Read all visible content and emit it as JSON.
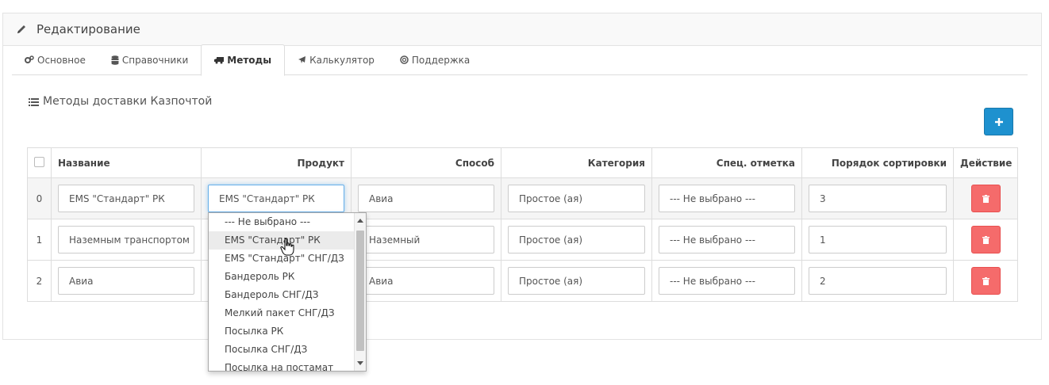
{
  "panel": {
    "title": "Редактирование",
    "icon": "pencil-icon"
  },
  "tabs": [
    {
      "label": "Основное",
      "icon": "cogs-icon",
      "active": false
    },
    {
      "label": "Справочники",
      "icon": "database-icon",
      "active": false
    },
    {
      "label": "Методы",
      "icon": "truck-icon",
      "active": true
    },
    {
      "label": "Калькулятор",
      "icon": "plane-icon",
      "active": false
    },
    {
      "label": "Поддержка",
      "icon": "life-ring-icon",
      "active": false
    }
  ],
  "section": {
    "title": "Методы доставки Казпочтой",
    "icon": "list-icon",
    "add_button_icon": "plus-icon"
  },
  "table": {
    "headers": {
      "name": "Название",
      "product": "Продукт",
      "method": "Способ",
      "category": "Категория",
      "special": "Спец. отметка",
      "sort": "Порядок сортировки",
      "action": "Действие"
    },
    "rows": [
      {
        "index": "0",
        "name": "EMS \"Стандарт\" РК",
        "product": "EMS \"Стандарт\" РК",
        "method": "Авиа",
        "category": "Простое (ая)",
        "special": "--- Не выбрано ---",
        "sort": "3"
      },
      {
        "index": "1",
        "name": "Наземным транспортом",
        "product": "",
        "method": "Наземный",
        "category": "Простое (ая)",
        "special": "--- Не выбрано ---",
        "sort": "1"
      },
      {
        "index": "2",
        "name": "Авиа",
        "product": "",
        "method": "Авиа",
        "category": "Простое (ая)",
        "special": "--- Не выбрано ---",
        "sort": "2"
      }
    ]
  },
  "dropdown": {
    "options": [
      "--- Не выбрано ---",
      "EMS \"Стандарт\" РК",
      "EMS \"Стандарт\" СНГ/ДЗ",
      "Бандероль РК",
      "Бандероль СНГ/ДЗ",
      "Мелкий пакет СНГ/ДЗ",
      "Посылка РК",
      "Посылка СНГ/ДЗ",
      "Посылка на постамат"
    ],
    "hovered_index": 1
  },
  "colors": {
    "primary": "#1e91cf",
    "danger": "#f56b6b",
    "focus": "#66afe9"
  }
}
